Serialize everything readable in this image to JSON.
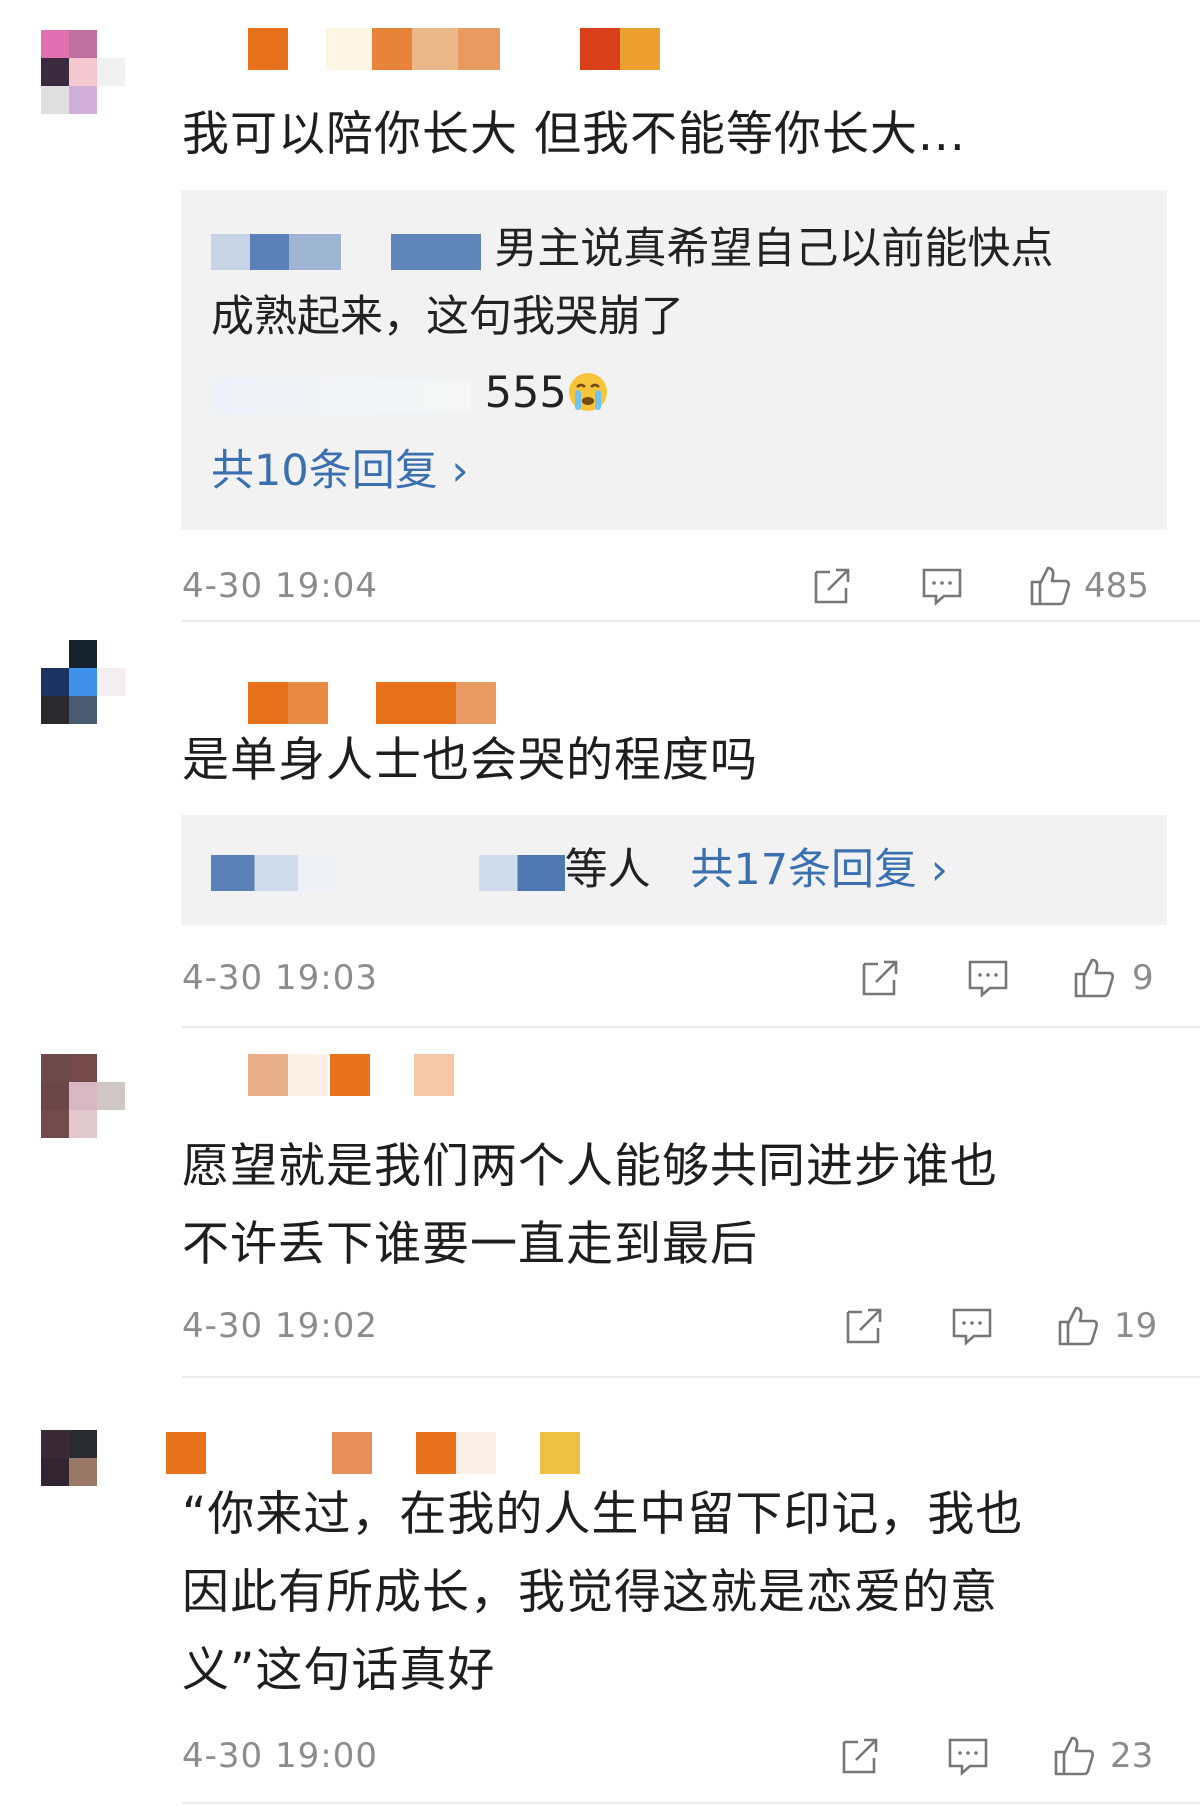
{
  "comments": [
    {
      "text_lines": [
        "我可以陪你长大 但我不能等你长大..."
      ],
      "replies": [
        {
          "line1": "男主说真希望自己以前能快点",
          "line2": "成熟起来，这句我哭崩了"
        },
        {
          "line1": "555"
        }
      ],
      "reply_link": "共10条回复 ›",
      "time": "4-30 19:04",
      "like_count": "485"
    },
    {
      "text_lines": [
        "是单身人士也会哭的程度吗"
      ],
      "reply_suffix": "等人",
      "reply_link": "共17条回复 ›",
      "time": "4-30 19:03",
      "like_count": "9"
    },
    {
      "text_lines": [
        "愿望就是我们两个人能够共同进步谁也",
        "不许丢下谁要一直走到最后"
      ],
      "time": "4-30 19:02",
      "like_count": "19"
    },
    {
      "text_lines": [
        "“你来过，在我的人生中留下印记，我也",
        "因此有所成长，我觉得这就是恋爱的意",
        "义”这句话真好"
      ],
      "time": "4-30 19:00",
      "like_count": "23"
    }
  ],
  "icons": {
    "share": "share-icon",
    "comment": "comment-icon",
    "like": "like-icon",
    "emoji": "crying-emoji-icon"
  },
  "colors": {
    "link": "#3b70b0",
    "meta": "#8c8c8c",
    "reply_bg": "#f2f2f2",
    "divider": "#ececec"
  }
}
